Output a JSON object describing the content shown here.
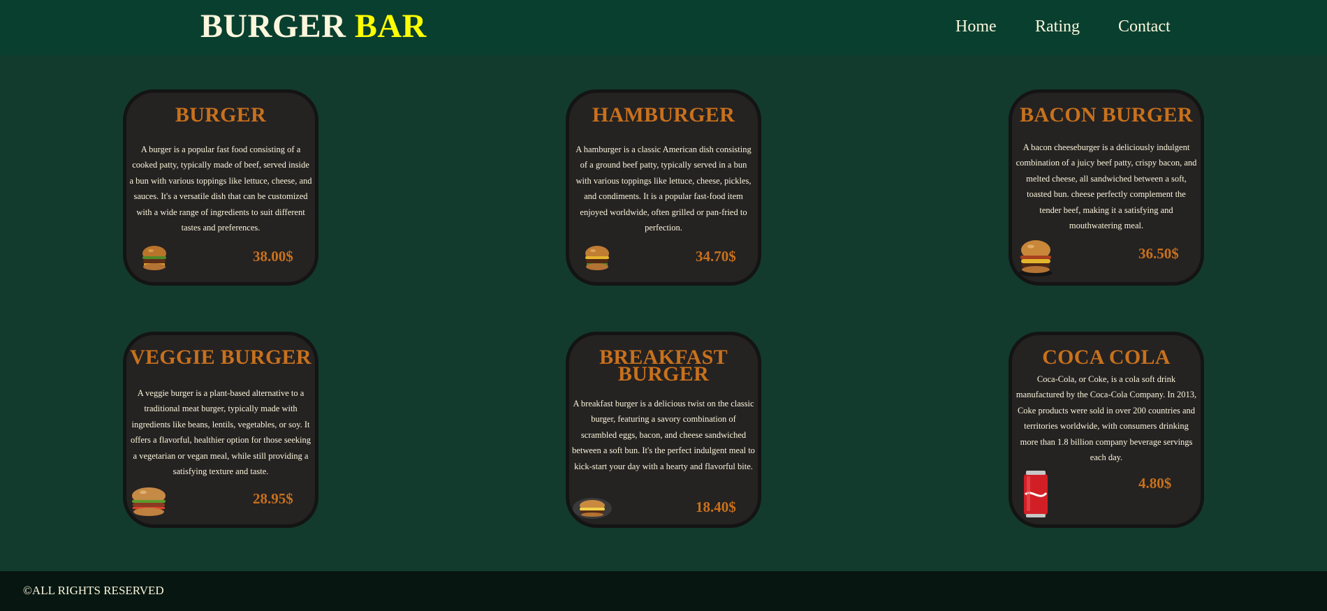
{
  "header": {
    "brand_main": "BURGER",
    "brand_accent": "BAR",
    "nav": [
      "Home",
      "Rating",
      "Contact"
    ]
  },
  "menu": [
    {
      "title": "BURGER",
      "description": "A burger is a popular fast food consisting of a cooked patty, typically made of beef, served inside a bun with various toppings like lettuce, cheese, and sauces. It's a versatile dish that can be customized with a wide range of ingredients to suit different tastes and preferences.",
      "price": "38.00$",
      "image": "burger-icon"
    },
    {
      "title": "HAMBURGER",
      "description": "A hamburger is a classic American dish consisting of a ground beef patty, typically served in a bun with various toppings like lettuce, cheese, pickles, and condiments. It is a popular fast-food item enjoyed worldwide, often grilled or pan-fried to perfection.",
      "price": "34.70$",
      "image": "hamburger-icon"
    },
    {
      "title": "BACON BURGER",
      "description": "A bacon cheeseburger is a deliciously indulgent combination of a juicy beef patty, crispy bacon, and melted cheese, all sandwiched between a soft, toasted bun. cheese perfectly complement the tender beef, making it a satisfying and mouthwatering meal.",
      "price": "36.50$",
      "image": "bacon-burger-icon"
    },
    {
      "title": "VEGGIE BURGER",
      "description": "A veggie burger is a plant-based alternative to a traditional meat burger, typically made with ingredients like beans, lentils, vegetables, or soy. It offers a flavorful, healthier option for those seeking a vegetarian or vegan meal, while still providing a satisfying texture and taste.",
      "price": "28.95$",
      "image": "veggie-burger-icon"
    },
    {
      "title": "BREAKFAST BURGER",
      "description": "A breakfast burger is a delicious twist on the classic burger, featuring a savory combination of scrambled eggs, bacon, and cheese sandwiched between a soft bun. It's the perfect indulgent meal to kick-start your day with a hearty and flavorful bite.",
      "price": "18.40$",
      "image": "breakfast-burger-icon"
    },
    {
      "title": "COCA COLA",
      "description": "Coca-Cola, or Coke, is a cola soft drink manufactured by the Coca-Cola Company. In 2013, Coke products were sold in over 200 countries and territories worldwide, with consumers drinking more than 1.8 billion company beverage servings each day.",
      "price": "4.80$",
      "image": "cola-can-icon"
    }
  ],
  "footer": {
    "text": "©ALL RIGHTS RESERVED"
  },
  "colors": {
    "page_bg": "#123b2d",
    "header_bg": "#093f2f",
    "card_bg": "#252222",
    "accent_orange": "#c8711c",
    "brand_yellow": "#ffff00",
    "cream_text": "#fbf6dc",
    "footer_bg": "#071611"
  }
}
